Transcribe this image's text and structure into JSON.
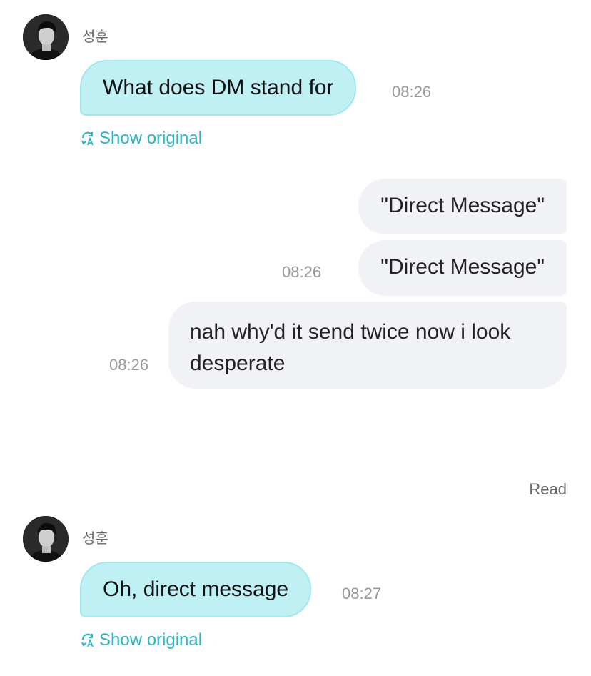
{
  "messages": [
    {
      "sender": "성훈",
      "text": "What does DM stand for",
      "time": "08:26",
      "show_original": "Show original"
    },
    {
      "text": "\"Direct Message\""
    },
    {
      "text": "\"Direct Message\"",
      "time": "08:26"
    },
    {
      "text": "nah why'd it send twice now i look desperate",
      "time": "08:26"
    },
    {
      "sender": "성훈",
      "text": "Oh, direct message",
      "time": "08:27",
      "show_original": "Show original"
    }
  ],
  "read_status": "Read",
  "colors": {
    "incoming_bubble": "#bff1f4",
    "outgoing_bubble": "#f1f2f6",
    "accent": "#2bb4c4"
  },
  "icons": {
    "translate": "translate-refresh-icon",
    "avatar": "avatar-photo"
  }
}
